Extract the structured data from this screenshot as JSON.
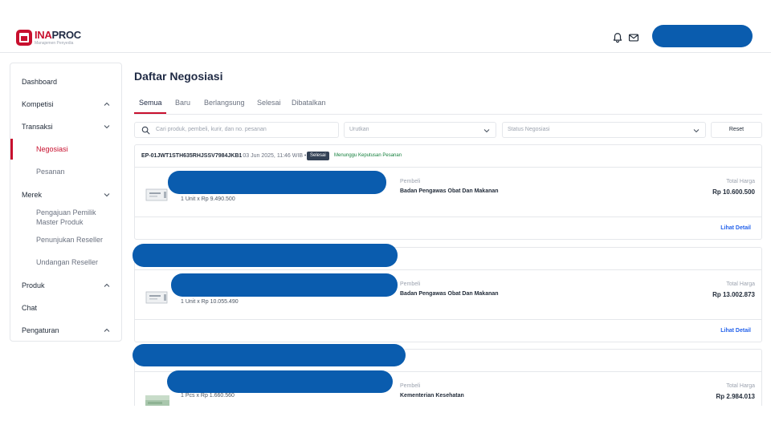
{
  "header": {
    "logo_brand_a": "INA",
    "logo_brand_b": "PROC",
    "logo_subtitle": "Manajemen Penyedia",
    "icons": [
      "bell-icon",
      "mail-icon"
    ]
  },
  "sidebar": {
    "items": [
      {
        "label": "Dashboard"
      },
      {
        "label": "Kompetisi",
        "icon": "chevron-up-icon"
      },
      {
        "label": "Transaksi",
        "icon": "chevron-down-icon"
      },
      {
        "label": "Negosiasi",
        "active": true
      },
      {
        "label": "Pesanan"
      },
      {
        "label": "Merek",
        "icon": "chevron-down-icon"
      },
      {
        "label": "Pengajuan Pemilik"
      },
      {
        "label": "Master Produk"
      },
      {
        "label": "Penunjukan Reseller"
      },
      {
        "label": "Undangan Reseller"
      },
      {
        "label": "Produk",
        "icon": "chevron-up-icon"
      },
      {
        "label": "Chat"
      },
      {
        "label": "Pengaturan",
        "icon": "chevron-up-icon"
      }
    ]
  },
  "main": {
    "title": "Daftar Negosiasi",
    "tabs": [
      {
        "label": "Semua",
        "active": true
      },
      {
        "label": "Baru"
      },
      {
        "label": "Berlangsung"
      },
      {
        "label": "Selesai"
      },
      {
        "label": "Dibatalkan"
      }
    ],
    "search_placeholder": "Cari produk, pembeli, kurir, dan no. pesanan",
    "sort_placeholder": "Urutkan",
    "status_placeholder": "Status Negosiasi",
    "reset_label": "Reset"
  },
  "orders": [
    {
      "order_id": "EP-01JWT1STH635RHJSSV7984JKB1",
      "date": "• 03 Jun 2025, 11:46 WIB •",
      "status": "Selesai",
      "status_note": "Menunggu Keputusan Pesanan",
      "unit_text": "1 Unit x Rp 9.490.500",
      "buyer_label": "Pembeli",
      "buyer": "Badan Pengawas Obat Dan Makanan",
      "total_label": "Total Harga",
      "total": "Rp 10.600.500",
      "detail_label": "Lihat Detail"
    },
    {
      "unit_text": "1 Unit x Rp 10.055.490",
      "buyer_label": "Pembeli",
      "buyer": "Badan Pengawas Obat Dan Makanan",
      "total_label": "Total Harga",
      "total": "Rp 13.002.873",
      "detail_label": "Lihat Detail"
    },
    {
      "unit_text": "1 Pcs x Rp 1.660.560",
      "buyer_label": "Pembeli",
      "buyer": "Kementerian Kesehatan",
      "total_label": "Total Harga",
      "total": "Rp 2.984.013"
    }
  ],
  "colors": {
    "brand": "#c8102e",
    "redaction": "#0a5cae",
    "link": "#2563eb",
    "status_badge": "#334155",
    "status_note": "#15803d"
  }
}
